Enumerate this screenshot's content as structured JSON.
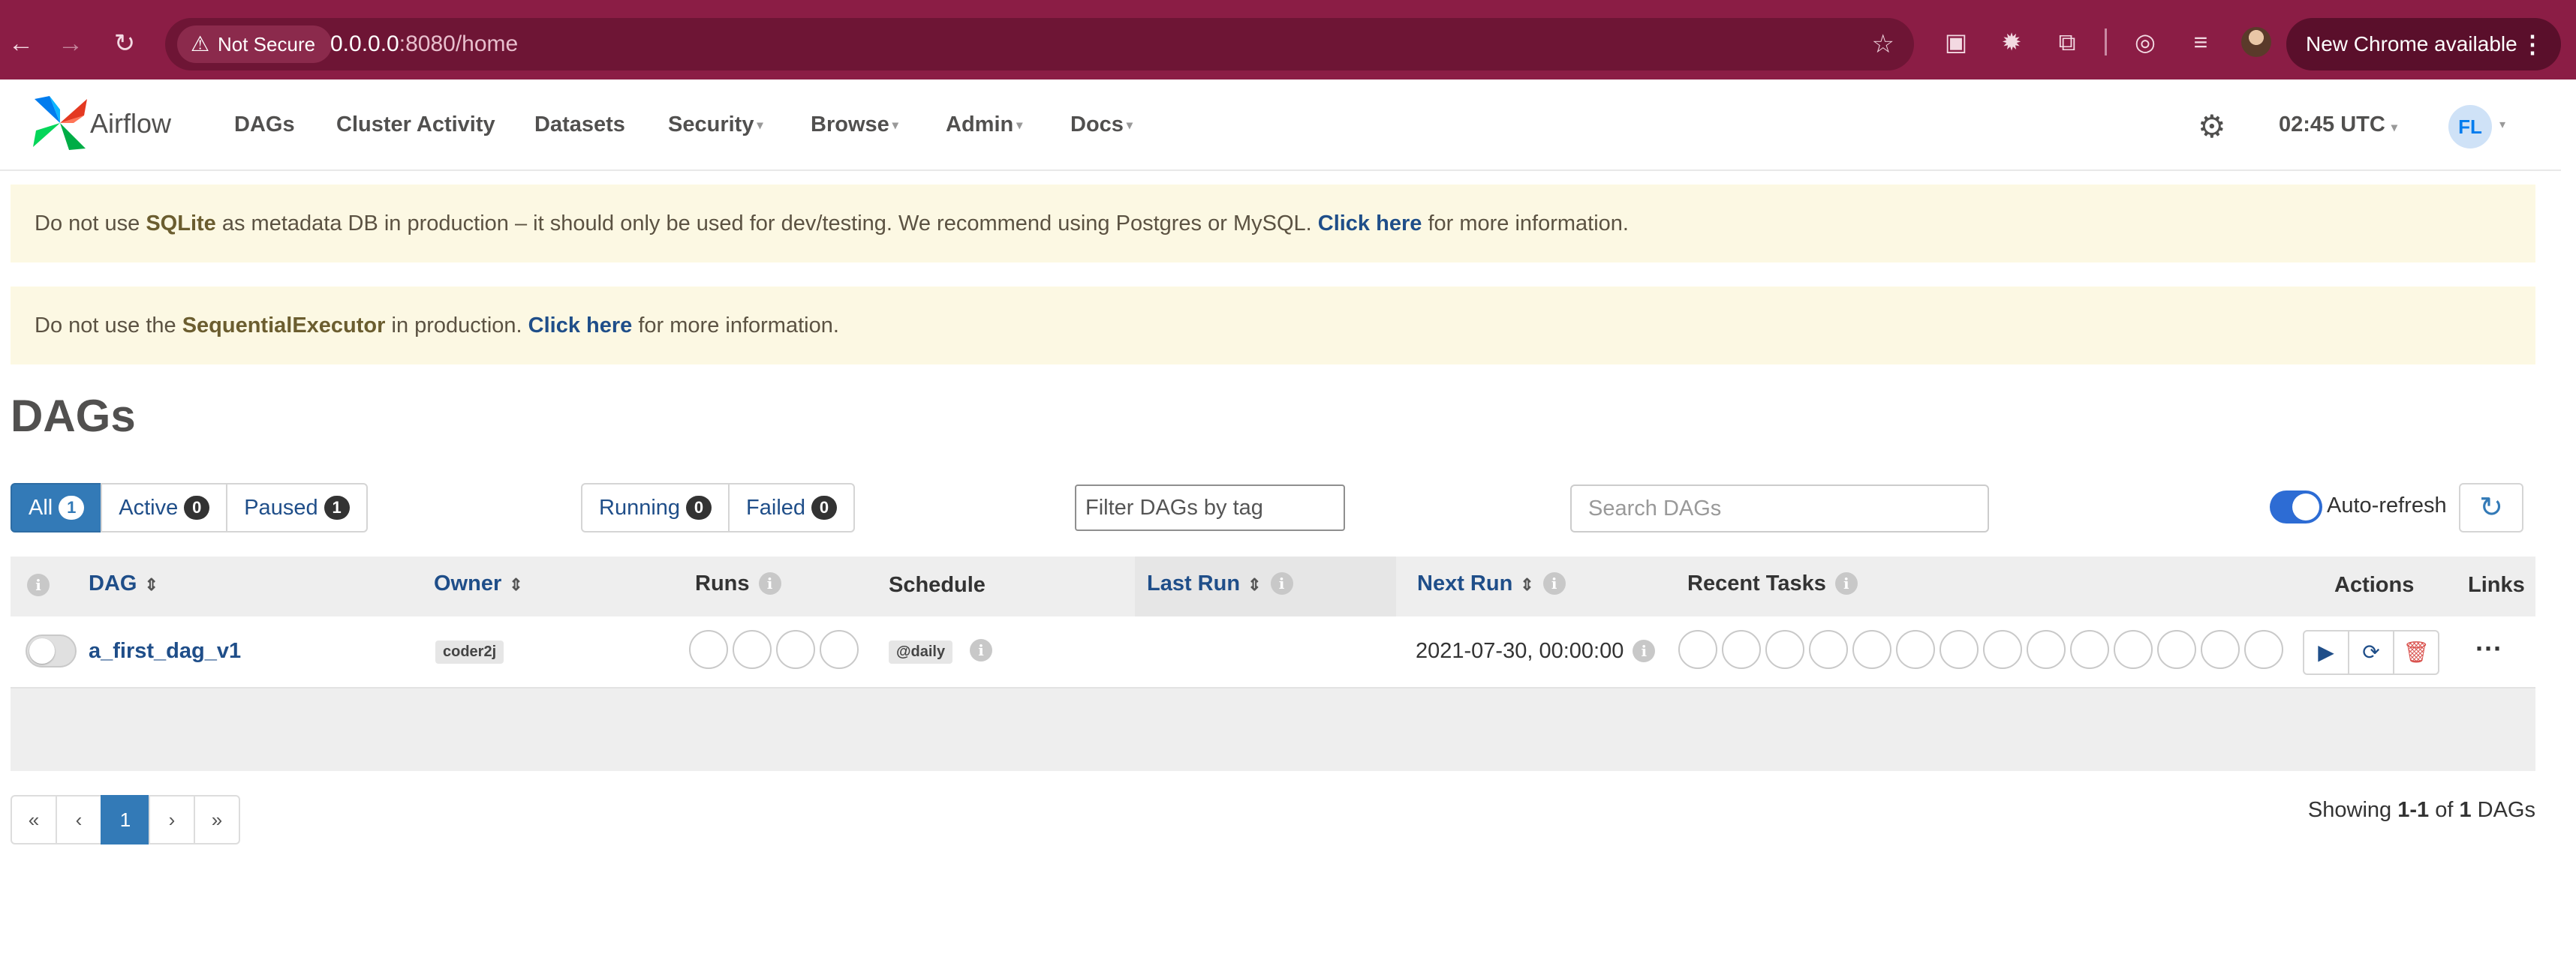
{
  "browser": {
    "security_label": "Not Secure",
    "url_host": "0.0.0.0",
    "url_path": ":8080/home",
    "update_label": "New Chrome available"
  },
  "navbar": {
    "brand": "Airflow",
    "menu": [
      {
        "label": "DAGs",
        "has_caret": false
      },
      {
        "label": "Cluster Activity",
        "has_caret": false
      },
      {
        "label": "Datasets",
        "has_caret": false
      },
      {
        "label": "Security",
        "has_caret": true
      },
      {
        "label": "Browse",
        "has_caret": true
      },
      {
        "label": "Admin",
        "has_caret": true
      },
      {
        "label": "Docs",
        "has_caret": true
      }
    ],
    "time": "02:45 UTC",
    "user_initials": "FL"
  },
  "alerts": {
    "sqlite": {
      "pre": "Do not use ",
      "bold": "SQLite",
      "mid": " as metadata DB in production – it should only be used for dev/testing. We recommend using Postgres or MySQL. ",
      "link": "Click here",
      "post": " for more information."
    },
    "executor": {
      "pre": "Do not use the ",
      "bold": "SequentialExecutor",
      "mid": " in production. ",
      "link": "Click here",
      "post": " for more information."
    }
  },
  "page": {
    "title": "DAGs"
  },
  "filters": {
    "status": [
      {
        "label": "All",
        "count": "1",
        "active": true
      },
      {
        "label": "Active",
        "count": "0",
        "active": false
      },
      {
        "label": "Paused",
        "count": "1",
        "active": false
      }
    ],
    "run_state": [
      {
        "label": "Running",
        "count": "0"
      },
      {
        "label": "Failed",
        "count": "0"
      }
    ],
    "tag_placeholder": "Filter DAGs by tag",
    "search_placeholder": "Search DAGs",
    "auto_refresh_label": "Auto-refresh",
    "auto_refresh_on": true
  },
  "table": {
    "headers": {
      "dag": "DAG",
      "owner": "Owner",
      "runs": "Runs",
      "schedule": "Schedule",
      "last_run": "Last Run",
      "next_run": "Next Run",
      "recent_tasks": "Recent Tasks",
      "actions": "Actions",
      "links": "Links"
    },
    "rows": [
      {
        "dag_id": "a_first_dag_v1",
        "owner": "coder2j",
        "schedule": "@daily",
        "last_run": "",
        "next_run": "2021-07-30, 00:00:00",
        "paused": true
      }
    ]
  },
  "pagination": {
    "first": "«",
    "prev": "‹",
    "current": "1",
    "next": "›",
    "last": "»"
  },
  "summary": {
    "pre": "Showing ",
    "range": "1-1",
    "mid": " of ",
    "total": "1",
    "post": " DAGs"
  },
  "colors": {
    "chrome_frame": "#8b1d45",
    "link_blue": "#1f4e89",
    "primary": "#337ab7",
    "alert_bg": "#fcf8e3"
  }
}
